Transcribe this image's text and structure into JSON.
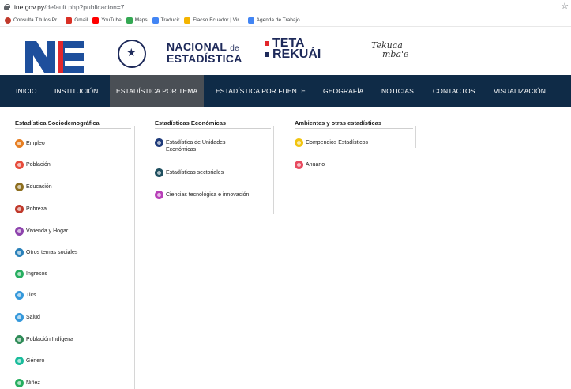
{
  "browser": {
    "url_host": "ine.gov.py",
    "url_path": "/default.php?publicacion=7",
    "bookmarks": [
      {
        "label": "Consulta Títulos Pr...",
        "color": "#c0392b"
      },
      {
        "label": "Gmail",
        "color": "#d93025"
      },
      {
        "label": "YouTube",
        "color": "#ff0000"
      },
      {
        "label": "Maps",
        "color": "#34a853"
      },
      {
        "label": "Traducir",
        "color": "#4285f4"
      },
      {
        "label": "Flacso Ecuador | Vir...",
        "color": "#f4b400"
      },
      {
        "label": "Agenda de Trabajo...",
        "color": "#4285f4"
      }
    ]
  },
  "header": {
    "nacional": "NACIONAL",
    "de": "de",
    "estadistica": "ESTADÍSTICA",
    "teta": "TETA",
    "rekuai": "REKUÁI",
    "script1": "Tekuaa",
    "script2": "mba'e"
  },
  "nav": {
    "items": [
      {
        "label": "INICIO"
      },
      {
        "label": "INSTITUCIÓN"
      },
      {
        "label": "ESTADÍSTICA POR TEMA"
      },
      {
        "label": "ESTADÍSTICA POR FUENTE"
      },
      {
        "label": "GEOGRAFÍA"
      },
      {
        "label": "NOTICIAS"
      },
      {
        "label": "CONTACTOS"
      },
      {
        "label": "VISUALIZACIÓN"
      }
    ],
    "active_index": 2
  },
  "menu": {
    "sociodemografica": {
      "title": "Estadística Sociodemográfica",
      "items": [
        {
          "label": "Empleo",
          "icon": "briefcase-icon",
          "color": "#e67e22"
        },
        {
          "label": "Población",
          "icon": "people-icon",
          "color": "#e74c3c"
        },
        {
          "label": "Educación",
          "icon": "book-icon",
          "color": "#8d6e1f"
        },
        {
          "label": "Pobreza",
          "icon": "hands-icon",
          "color": "#c0392b"
        },
        {
          "label": "Vivienda y Hogar",
          "icon": "house-icon",
          "color": "#8e44ad"
        },
        {
          "label": "Otros temas sociales",
          "icon": "info-icon",
          "color": "#2980b9"
        },
        {
          "label": "Ingresos",
          "icon": "money-icon",
          "color": "#27ae60"
        },
        {
          "label": "Tics",
          "icon": "tech-icon",
          "color": "#3498db"
        },
        {
          "label": "Salud",
          "icon": "health-icon",
          "color": "#3498db"
        },
        {
          "label": "Población Indígena",
          "icon": "indigenous-icon",
          "color": "#2e8b57"
        },
        {
          "label": "Género",
          "icon": "gender-icon",
          "color": "#1abc9c"
        },
        {
          "label": "Niñez",
          "icon": "child-icon",
          "color": "#27ae60"
        }
      ]
    },
    "economicas": {
      "title": "Estadísticas Económicas",
      "items": [
        {
          "label": "Estadística de Unidades Económicas",
          "icon": "building-icon",
          "color": "#1e3a7a"
        },
        {
          "label": "Estadísticas sectoriales",
          "icon": "sector-icon",
          "color": "#1f4f5f"
        },
        {
          "label": "Ciencias tecnológica e innovación",
          "icon": "science-icon",
          "color": "#b83fb8"
        }
      ]
    },
    "ambientes": {
      "title": "Ambientes y otras estadísticas",
      "items": [
        {
          "label": "Compendios Estadísticos",
          "icon": "compendium-icon",
          "color": "#f1c40f"
        },
        {
          "label": "Anuario",
          "icon": "yearbook-icon",
          "color": "#e84a5f"
        }
      ]
    }
  }
}
